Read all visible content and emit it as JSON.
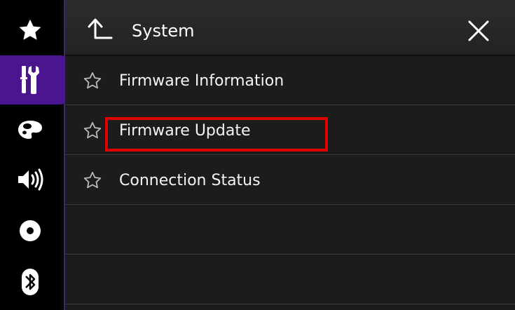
{
  "header": {
    "title": "System",
    "back_icon": "back-arrow-icon",
    "close_icon": "close-icon"
  },
  "sidebar": {
    "items": [
      {
        "icon": "star-icon",
        "active": false
      },
      {
        "icon": "tools-icon",
        "active": true
      },
      {
        "icon": "palette-icon",
        "active": false
      },
      {
        "icon": "speaker-icon",
        "active": false
      },
      {
        "icon": "disc-icon",
        "active": false
      },
      {
        "icon": "bluetooth-icon",
        "active": false
      }
    ]
  },
  "menu": {
    "items": [
      {
        "label": "Firmware Information",
        "icon": "star-outline-icon"
      },
      {
        "label": "Firmware Update",
        "icon": "star-outline-icon",
        "highlighted": true
      },
      {
        "label": "Connection Status",
        "icon": "star-outline-icon"
      },
      {
        "label": ""
      },
      {
        "label": ""
      }
    ]
  },
  "colors": {
    "active_tab": "#4a158e",
    "highlight_border": "#e00000",
    "panel_bg": "#1c1c1c"
  }
}
